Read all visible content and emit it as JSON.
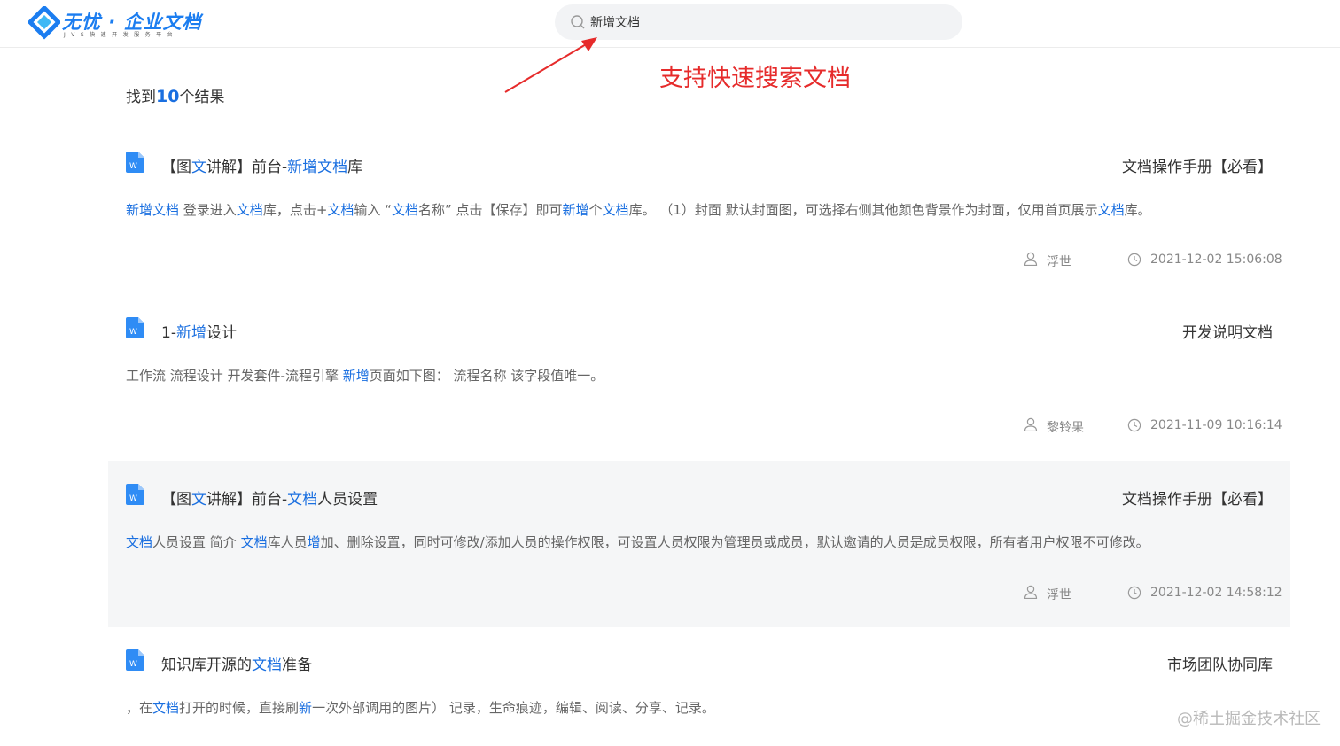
{
  "header": {
    "logo_title": "无忧 · 企业文档",
    "logo_subtitle": "JVS快速开发服务平台",
    "search_value": "新增文档"
  },
  "annotation": "支持快速搜索文档",
  "results": {
    "prefix": "找到",
    "count": "10",
    "suffix": "个结果"
  },
  "items": [
    {
      "title": [
        [
          "【图",
          false
        ],
        [
          "文",
          true
        ],
        [
          "讲解】前台-",
          false
        ],
        [
          "新增文档",
          true
        ],
        [
          "库",
          false
        ]
      ],
      "category": "文档操作手册【必看】",
      "snippet": [
        [
          "新增文档",
          true
        ],
        [
          " 登录进入",
          false
        ],
        [
          "文档",
          true
        ],
        [
          "库，点击+",
          false
        ],
        [
          "文档",
          true
        ],
        [
          "输入 “",
          false
        ],
        [
          "文档",
          true
        ],
        [
          "名称” 点击【保存】即可",
          false
        ],
        [
          "新增",
          true
        ],
        [
          "个",
          false
        ],
        [
          "文档",
          true
        ],
        [
          "库。 （1）封面 默认封面图，可选择右侧其他颜色背景作为封面，仅用首页展示",
          false
        ],
        [
          "文档",
          true
        ],
        [
          "库。",
          false
        ]
      ],
      "author": "浮世",
      "time": "2021-12-02 15:06:08"
    },
    {
      "title": [
        [
          "1-",
          false
        ],
        [
          "新增",
          true
        ],
        [
          "设计",
          false
        ]
      ],
      "category": "开发说明文档",
      "snippet": [
        [
          "工作流 流程设计 开发套件-流程引擎 ",
          false
        ],
        [
          "新增",
          true
        ],
        [
          "页面如下图： 流程名称 该字段值唯一。",
          false
        ]
      ],
      "author": "黎铃果",
      "time": "2021-11-09 10:16:14"
    },
    {
      "title": [
        [
          "【图",
          false
        ],
        [
          "文",
          true
        ],
        [
          "讲解】前台-",
          false
        ],
        [
          "文档",
          true
        ],
        [
          "人员设置",
          false
        ]
      ],
      "category": "文档操作手册【必看】",
      "snippet": [
        [
          "文档",
          true
        ],
        [
          "人员设置 简介 ",
          false
        ],
        [
          "文档",
          true
        ],
        [
          "库人员",
          false
        ],
        [
          "增",
          true
        ],
        [
          "加、删除设置，同时可修改/添加人员的操作权限，可设置人员权限为管理员或成员，默认邀请的人员是成员权限，所有者用户权限不可修改。",
          false
        ]
      ],
      "author": "浮世",
      "time": "2021-12-02 14:58:12"
    },
    {
      "title": [
        [
          "知识库开源的",
          false
        ],
        [
          "文档",
          true
        ],
        [
          "准备",
          false
        ]
      ],
      "category": "市场团队协同库",
      "snippet": [
        [
          "，在",
          false
        ],
        [
          "文档",
          true
        ],
        [
          "打开的时候，直接刷",
          false
        ],
        [
          "新",
          true
        ],
        [
          "一次外部调用的图片） 记录，生命痕迹，编辑、阅读、分享、记录。",
          false
        ]
      ]
    }
  ],
  "watermark": "@稀土掘金技术社区",
  "colors": {
    "accent": "#1a6fe0",
    "annotation": "#e62b2b",
    "hover_bg": "#f5f6f7"
  }
}
